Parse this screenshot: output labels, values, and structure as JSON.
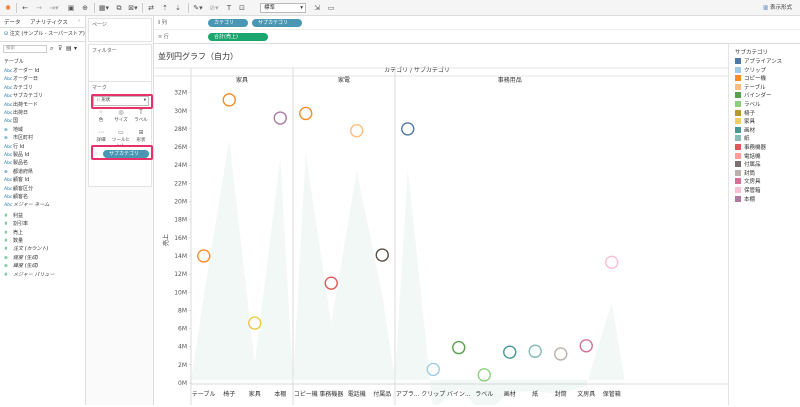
{
  "toolbar": {
    "fit_value": "標準",
    "show_me": "表示形式",
    "icons": [
      "tableau-logo-icon",
      "undo-icon",
      "redo-icon",
      "redo-dropdown-icon",
      "save-icon",
      "new-datasource-icon",
      "new-worksheet-icon",
      "duplicate-icon",
      "clear-icon",
      "swap-icon",
      "sort-ascending-icon",
      "sort-descending-icon",
      "highlight-icon",
      "group-icon",
      "label-icon",
      "fix-axes-icon",
      "fit-icon",
      "presentation-icon",
      "show-me-icon"
    ]
  },
  "left_pane": {
    "tabs": [
      "データ",
      "アナリティクス"
    ],
    "datasource": "注文 (サンプル - スーパーストア)",
    "search_placeholder": "検索",
    "section_table": "テーブル",
    "fields": [
      {
        "type": "Abc",
        "name": "オーダー Id"
      },
      {
        "type": "Abc",
        "name": "オーダー日"
      },
      {
        "type": "Abc",
        "name": "カテゴリ"
      },
      {
        "type": "Abc",
        "name": "サブカテゴリ"
      },
      {
        "type": "Abc",
        "name": "出荷モード"
      },
      {
        "type": "Abc",
        "name": "出荷日"
      },
      {
        "type": "Abc",
        "name": "国"
      },
      {
        "type": "geo",
        "name": "地域"
      },
      {
        "type": "geo",
        "name": "市区町村"
      },
      {
        "type": "Abc",
        "name": "行 Id"
      },
      {
        "type": "Abc",
        "name": "製品 Id"
      },
      {
        "type": "Abc",
        "name": "製品名"
      },
      {
        "type": "geo",
        "name": "都道府県"
      },
      {
        "type": "Abc",
        "name": "顧客 Id"
      },
      {
        "type": "Abc",
        "name": "顧客区分"
      },
      {
        "type": "Abc",
        "name": "顧客名"
      },
      {
        "type": "Abc",
        "name": "メジャー ネーム",
        "italic": true
      }
    ],
    "measures": [
      {
        "type": "#",
        "name": "利益"
      },
      {
        "type": "#",
        "name": "割引率"
      },
      {
        "type": "#",
        "name": "売上"
      },
      {
        "type": "#",
        "name": "数量"
      },
      {
        "type": "#",
        "name": "注文 (カウント)",
        "italic": true
      },
      {
        "type": "geo",
        "name": "経度 (生成)",
        "italic": true
      },
      {
        "type": "geo",
        "name": "緯度 (生成)",
        "italic": true
      },
      {
        "type": "#",
        "name": "メジャー バリュー",
        "italic": true
      }
    ]
  },
  "pages_label": "ページ",
  "filters_label": "フィルター",
  "marks": {
    "title": "マーク",
    "type": "形状",
    "buttons": [
      {
        "label": "色",
        "glyph": "⁘"
      },
      {
        "label": "サイズ",
        "glyph": "◎"
      },
      {
        "label": "ラベル",
        "glyph": "T"
      },
      {
        "label": "詳細",
        "glyph": "⋯"
      },
      {
        "label": "ツールヒント",
        "glyph": "▭"
      },
      {
        "label": "形状",
        "glyph": "⊞"
      }
    ],
    "pill": "サブカテゴリ"
  },
  "shelves": {
    "columns_label": "列",
    "rows_label": "行",
    "columns": [
      "カテゴリ",
      "サブカテゴリ"
    ],
    "rows": [
      "合計(売上)"
    ]
  },
  "chart_data": {
    "type": "scatter",
    "title": "並列円グラフ（自力）",
    "header": "カテゴリ / サブカテゴリ",
    "ylabel": "売上",
    "ylim": [
      0,
      33500000
    ],
    "yticks": [
      "0M",
      "2M",
      "4M",
      "6M",
      "8M",
      "10M",
      "12M",
      "14M",
      "16M",
      "18M",
      "20M",
      "22M",
      "24M",
      "26M",
      "28M",
      "30M",
      "32M"
    ],
    "grid": false,
    "legend_position": "right",
    "categories": [
      {
        "name": "家具",
        "points": [
          {
            "sub": "テーブル",
            "label": "テーブル",
            "value": 14000000,
            "color": "#f28e2b"
          },
          {
            "sub": "椅子",
            "label": "椅子",
            "value": 31200000,
            "color": "#f28e2b"
          },
          {
            "sub": "家具",
            "label": "家具",
            "value": 6600000,
            "color": "#edc948"
          },
          {
            "sub": "本棚",
            "label": "本棚",
            "value": 29200000,
            "color": "#b07aa1"
          }
        ]
      },
      {
        "name": "家電",
        "points": [
          {
            "sub": "コピー機",
            "label": "コピー機",
            "value": 29700000,
            "color": "#f28e2b"
          },
          {
            "sub": "事務機器",
            "label": "事務機器",
            "value": 11000000,
            "color": "#e15759"
          },
          {
            "sub": "電話機",
            "label": "電話機",
            "value": 27800000,
            "color": "#ffbe7d"
          },
          {
            "sub": "付属品",
            "label": "付属品",
            "value": 14100000,
            "color": "#59504a"
          }
        ]
      },
      {
        "name": "事務用品",
        "points": [
          {
            "sub": "アプライアンス",
            "label": "アプラ...",
            "value": 28000000,
            "color": "#4e79a7"
          },
          {
            "sub": "クリップ",
            "label": "クリップ",
            "value": 1500000,
            "color": "#a0cbe8"
          },
          {
            "sub": "バインダー",
            "label": "バイン...",
            "value": 3900000,
            "color": "#59a14f"
          },
          {
            "sub": "ラベル",
            "label": "ラベル",
            "value": 900000,
            "color": "#8cd17d"
          },
          {
            "sub": "画材",
            "label": "画材",
            "value": 3400000,
            "color": "#499894"
          },
          {
            "sub": "紙",
            "label": "紙",
            "value": 3500000,
            "color": "#86bcb6"
          },
          {
            "sub": "封筒",
            "label": "封筒",
            "value": 3200000,
            "color": "#bab0ac"
          },
          {
            "sub": "文房具",
            "label": "文房具",
            "value": 4100000,
            "color": "#d37295"
          },
          {
            "sub": "保管箱",
            "label": "保管箱",
            "value": 13300000,
            "color": "#fabfd2"
          }
        ]
      }
    ]
  },
  "legend": {
    "title": "サブカテゴリ",
    "items": [
      {
        "name": "アプライアンス",
        "color": "#4e79a7"
      },
      {
        "name": "クリップ",
        "color": "#a0cbe8"
      },
      {
        "name": "コピー機",
        "color": "#f28e2b"
      },
      {
        "name": "テーブル",
        "color": "#ffbe7d"
      },
      {
        "name": "バインダー",
        "color": "#59a14f"
      },
      {
        "name": "ラベル",
        "color": "#8cd17d"
      },
      {
        "name": "椅子",
        "color": "#b6992d"
      },
      {
        "name": "家具",
        "color": "#f1ce63"
      },
      {
        "name": "画材",
        "color": "#499894"
      },
      {
        "name": "紙",
        "color": "#86bcb6"
      },
      {
        "name": "事務機器",
        "color": "#e15759"
      },
      {
        "name": "電話機",
        "color": "#ff9d9a"
      },
      {
        "name": "付属品",
        "color": "#79706e"
      },
      {
        "name": "封筒",
        "color": "#bab0ac"
      },
      {
        "name": "文房具",
        "color": "#d37295"
      },
      {
        "name": "保管箱",
        "color": "#fabfd2"
      },
      {
        "name": "本棚",
        "color": "#b07aa1"
      }
    ]
  }
}
